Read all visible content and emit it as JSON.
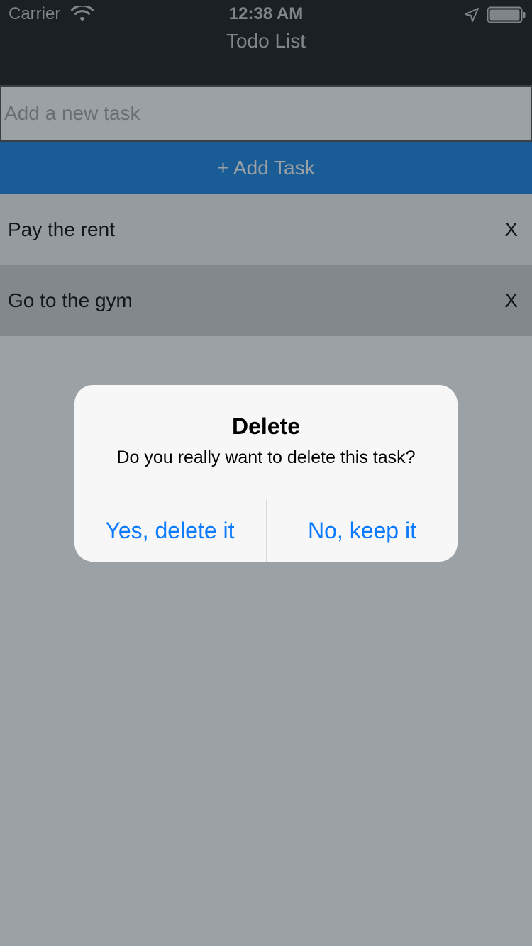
{
  "status_bar": {
    "carrier": "Carrier",
    "time": "12:38 AM"
  },
  "nav": {
    "title": "Todo List"
  },
  "input": {
    "placeholder": "Add a new task",
    "value": ""
  },
  "add_button": {
    "label": "+ Add Task",
    "color": "#1e88e5"
  },
  "tasks": [
    {
      "text": "Pay the rent",
      "delete_label": "X"
    },
    {
      "text": "Go to the gym",
      "delete_label": "X"
    }
  ],
  "alert": {
    "title": "Delete",
    "message": "Do you really want to delete this task?",
    "confirm_label": "Yes, delete it",
    "cancel_label": "No, keep it",
    "button_color": "#0a7aff"
  },
  "icons": {
    "wifi": "wifi-icon",
    "location": "location-arrow-icon",
    "battery": "battery-icon"
  }
}
